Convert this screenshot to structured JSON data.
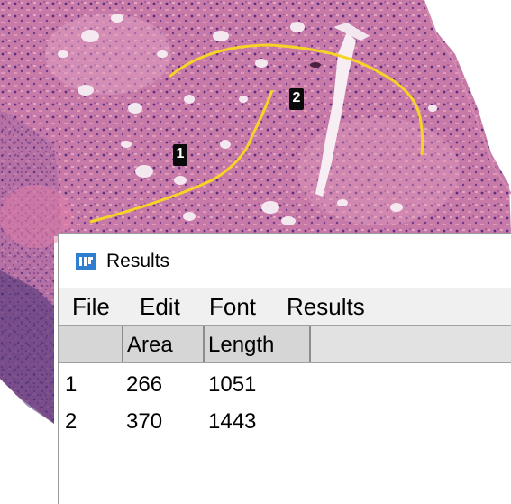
{
  "image": {
    "description_icons": [
      "roi-label-1",
      "roi-label-2"
    ],
    "roi_labels": [
      "1",
      "2"
    ],
    "annotation_color": "#f5d327"
  },
  "results_window": {
    "title": "Results",
    "icon": "imagej-icon",
    "menu": [
      "File",
      "Edit",
      "Font",
      "Results"
    ],
    "columns": [
      "",
      "Area",
      "Length"
    ],
    "rows": [
      {
        "index": "1",
        "area": "266",
        "length": "1051"
      },
      {
        "index": "2",
        "area": "370",
        "length": "1443"
      }
    ]
  },
  "colors": {
    "menu_bg": "#f0f0f0",
    "header_bg": "#d6d6d6",
    "icon_blue": "#2f7fd0"
  }
}
